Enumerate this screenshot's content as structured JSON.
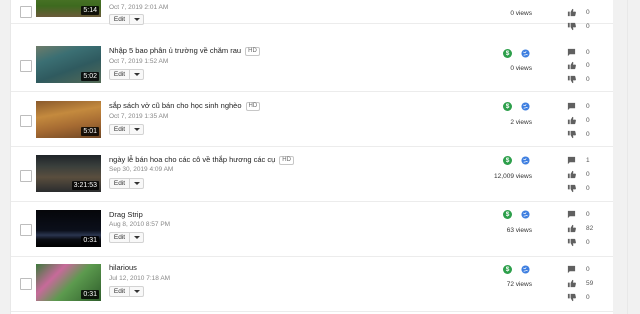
{
  "icons": {
    "monetization": "dollar-icon",
    "visibility": "globe-icon",
    "comments": "comment-icon",
    "likes": "thumbs-up-icon",
    "dislikes": "thumbs-down-icon"
  },
  "colors": {
    "monetization": "#2d9f4b",
    "visibility": "#3d7ee0",
    "stat_icon": "#606060"
  },
  "edit_label": "Edit",
  "hd_label": "HD",
  "money_symbol": "$",
  "videos": [
    {
      "title": "",
      "hd": false,
      "date": "Oct 7, 2019 2:01 AM",
      "duration": "5:14",
      "views": "0 views",
      "comments": "",
      "likes": "0",
      "dislikes": "0",
      "monetized": false,
      "public": false
    },
    {
      "title": "Nhập 5 bao phân ủ trường về chăm rau",
      "hd": true,
      "date": "Oct 7, 2019 1:52 AM",
      "duration": "5:02",
      "views": "0 views",
      "comments": "0",
      "likes": "0",
      "dislikes": "0",
      "monetized": true,
      "public": true
    },
    {
      "title": "sắp sách vở cũ bán cho học sinh nghèo",
      "hd": true,
      "date": "Oct 7, 2019 1:35 AM",
      "duration": "5:01",
      "views": "2 views",
      "comments": "0",
      "likes": "0",
      "dislikes": "0",
      "monetized": true,
      "public": true
    },
    {
      "title": "ngày lễ bán hoa cho các cô về thắp hương các cụ",
      "hd": true,
      "date": "Sep 30, 2019 4:09 AM",
      "duration": "3:21:53",
      "views": "12,009 views",
      "comments": "1",
      "likes": "0",
      "dislikes": "0",
      "monetized": true,
      "public": true
    },
    {
      "title": "Drag Strip",
      "hd": false,
      "date": "Aug 8, 2010 8:57 PM",
      "duration": "0:31",
      "views": "63 views",
      "comments": "0",
      "likes": "82",
      "dislikes": "0",
      "monetized": true,
      "public": true
    },
    {
      "title": "hilarious",
      "hd": false,
      "date": "Jul 12, 2010 7:18 AM",
      "duration": "0:31",
      "views": "72 views",
      "comments": "0",
      "likes": "59",
      "dislikes": "0",
      "monetized": true,
      "public": true
    }
  ]
}
